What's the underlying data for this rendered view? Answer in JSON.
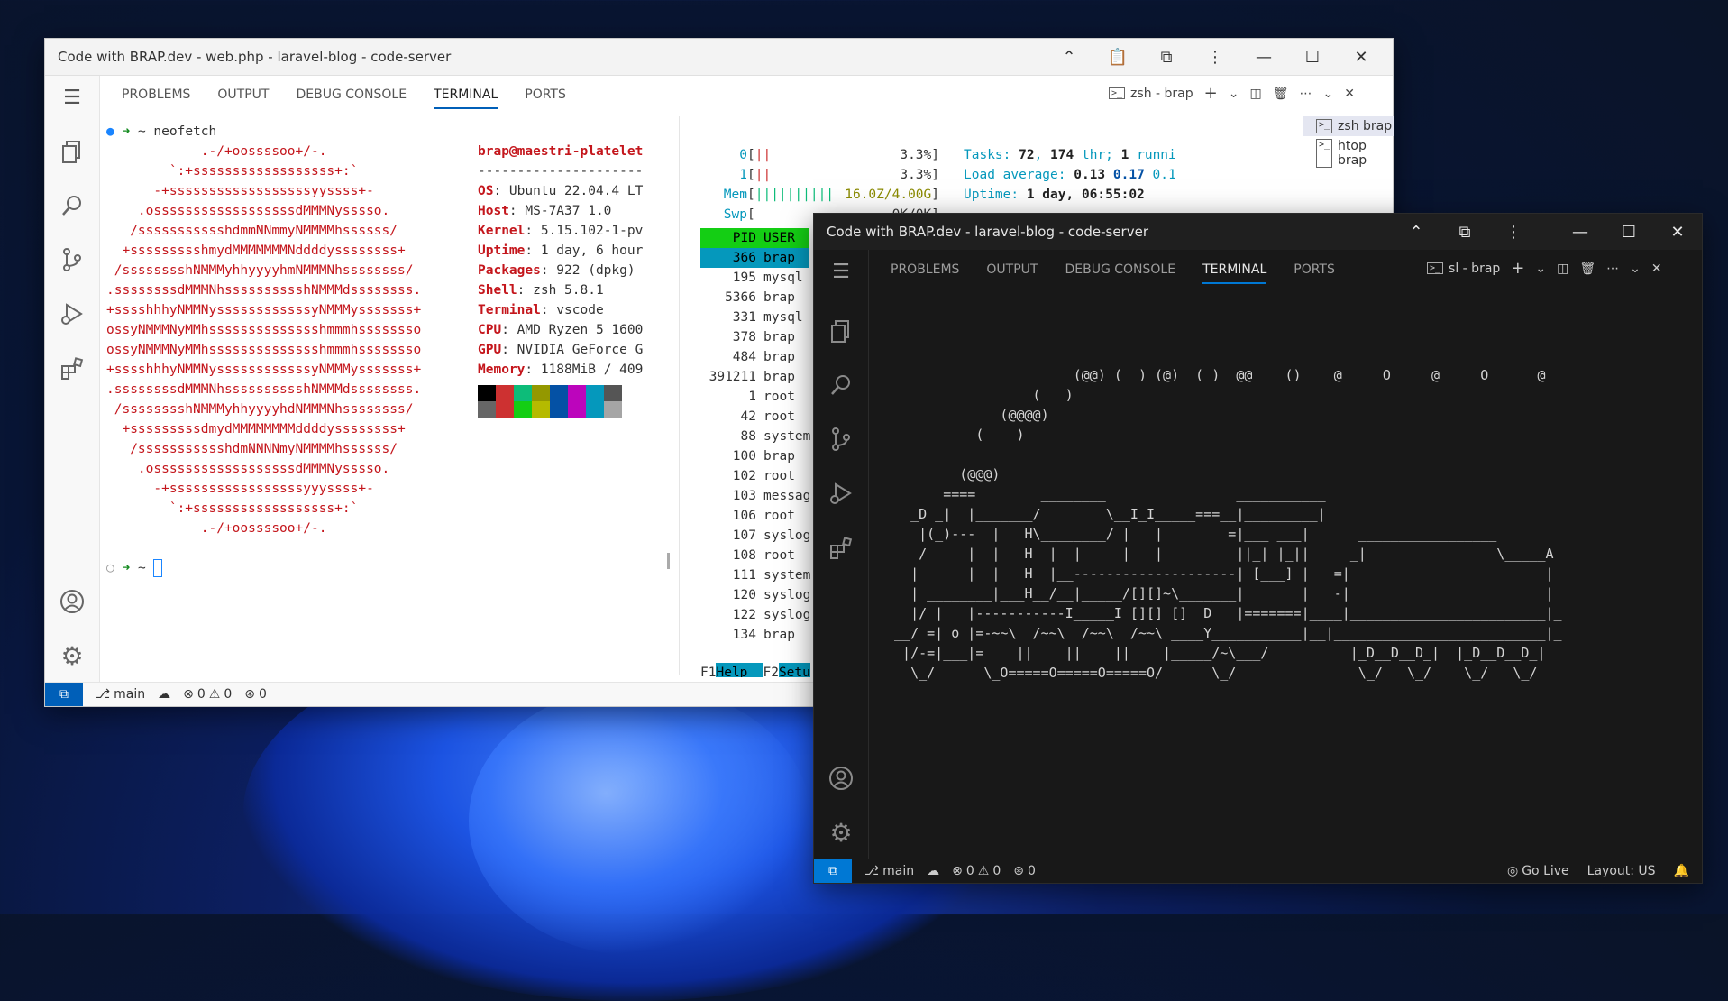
{
  "win1": {
    "title": "Code with BRAP.dev - web.php - laravel-blog - code-server",
    "tabs": [
      "PROBLEMS",
      "OUTPUT",
      "DEBUG CONSOLE",
      "TERMINAL",
      "PORTS"
    ],
    "terminal_selector": "zsh - brap",
    "terminal_list": [
      "zsh brap",
      "htop brap"
    ],
    "prompt1": "~ neofetch",
    "prompt2": "~",
    "logo": [
      "            .-/+oossssoo+/-.",
      "        `:+ssssssssssssssssss+:`",
      "      -+ssssssssssssssssssyyssss+-",
      "    .ossssssssssssssssssdMMMNysssso.",
      "   /ssssssssssshdmmNNmmyNMMMMhssssss/",
      "  +ssssssssshmydMMMMMMMNddddyssssssss+",
      " /sssssssshNMMMyhhyyyyhmNMMMNhssssssss/",
      ".ssssssssdMMMNhsssssssssshNMMMdssssssss.",
      "+sssshhhyNMMNyssssssssssssyNMMMysssssss+",
      "ossyNMMMNyMMhsssssssssssssshmmmhssssssso",
      "ossyNMMMNyMMhsssssssssssssshmmmhssssssso",
      "+sssshhhyNMMNyssssssssssssyNMMMysssssss+",
      ".ssssssssdMMMNhsssssssssshNMMMdssssssss.",
      " /sssssssshNMMMyhhyyyyhdNMMMNhssssssss/",
      "  +sssssssssdmydMMMMMMMMddddyssssssss+",
      "   /ssssssssssshdmNNNNmyNMMMMhssssss/",
      "    .ossssssssssssssssssdMMMNysssso.",
      "      -+sssssssssssssssssyyyssss+-",
      "        `:+ssssssssssssssssss+:`",
      "            .-/+oossssoo+/-."
    ],
    "userhost": "brap@maestri-platelet",
    "separator": "---------------------",
    "info": [
      {
        "k": "OS",
        "v": ": Ubuntu 22.04.4 LT"
      },
      {
        "k": "Host",
        "v": ": MS-7A37 1.0"
      },
      {
        "k": "Kernel",
        "v": ": 5.15.102-1-pv"
      },
      {
        "k": "Uptime",
        "v": ": 1 day, 6 hour"
      },
      {
        "k": "Packages",
        "v": ": 922 (dpkg)"
      },
      {
        "k": "Shell",
        "v": ": zsh 5.8.1"
      },
      {
        "k": "Terminal",
        "v": ": vscode"
      },
      {
        "k": "CPU",
        "v": ": AMD Ryzen 5 1600"
      },
      {
        "k": "GPU",
        "v": ": NVIDIA GeForce G"
      },
      {
        "k": "Memory",
        "v": ": 1188MiB / 409"
      }
    ],
    "palette_top": [
      "#000000",
      "#cd3131",
      "#0dbc79",
      "#949800",
      "#0451a5",
      "#bc05bc",
      "#0598bc",
      "#555555"
    ],
    "palette_bottom": [
      "#666666",
      "#cd3131",
      "#14ce14",
      "#b5ba00",
      "#0451a5",
      "#bc05bc",
      "#0598bc",
      "#a5a5a5"
    ],
    "htop": {
      "cpu0": {
        "label": "0",
        "bars": "||",
        "pct": "3.3%"
      },
      "cpu1": {
        "label": "1",
        "bars": "||",
        "pct": "3.3%"
      },
      "mem": {
        "label": "Mem",
        "bars": "||||||||||",
        "val": "16.0Z/4.00G"
      },
      "swp": {
        "label": "Swp",
        "val": "0K/0K"
      },
      "tasks": "Tasks: ",
      "tasks_n1": "72",
      "tasks_sep": ", ",
      "tasks_n2": "174",
      "tasks_rest": " thr; ",
      "tasks_n3": "1",
      "tasks_tail": " runni",
      "load": "Load average: ",
      "load1": "0.13",
      "load2": "0.17",
      "load3": "0.1",
      "uptime_label": "Uptime: ",
      "uptime_val": "1 day, 06:55:02",
      "header_pid": "PID",
      "header_user": "USER",
      "rows": [
        {
          "pid": "366",
          "user": "brap"
        },
        {
          "pid": "195",
          "user": "mysql"
        },
        {
          "pid": "5366",
          "user": "brap"
        },
        {
          "pid": "331",
          "user": "mysql"
        },
        {
          "pid": "378",
          "user": "brap"
        },
        {
          "pid": "484",
          "user": "brap"
        },
        {
          "pid": "391211",
          "user": "brap"
        },
        {
          "pid": "1",
          "user": "root"
        },
        {
          "pid": "42",
          "user": "root"
        },
        {
          "pid": "88",
          "user": "system"
        },
        {
          "pid": "100",
          "user": "brap"
        },
        {
          "pid": "102",
          "user": "root"
        },
        {
          "pid": "103",
          "user": "messag"
        },
        {
          "pid": "106",
          "user": "root"
        },
        {
          "pid": "107",
          "user": "syslog"
        },
        {
          "pid": "108",
          "user": "root"
        },
        {
          "pid": "111",
          "user": "system"
        },
        {
          "pid": "120",
          "user": "syslog"
        },
        {
          "pid": "122",
          "user": "syslog"
        },
        {
          "pid": "134",
          "user": "brap"
        }
      ],
      "f1": "F1",
      "f1_label": "Help",
      "f2": "F2",
      "f2_label": "Setu"
    },
    "status": {
      "branch": "main",
      "errors": "0",
      "warnings": "0",
      "ports": "0"
    }
  },
  "win2": {
    "title": "Code with BRAP.dev - laravel-blog - code-server",
    "tabs": [
      "PROBLEMS",
      "OUTPUT",
      "DEBUG CONSOLE",
      "TERMINAL",
      "PORTS"
    ],
    "terminal_selector": "sl - brap",
    "train": [
      "                       (@@) (  ) (@)  ( )  @@    ()    @     O     @     O      @",
      "                  (   )",
      "              (@@@@)",
      "           (    )",
      "",
      "         (@@@)",
      "       ====        ________                ___________",
      "   _D _|  |_______/        \\__I_I_____===__|_________|",
      "    |(_)---  |   H\\________/ |   |        =|___ ___|      _________________",
      "    /     |  |   H  |  |     |   |         ||_| |_||     _|                \\_____A",
      "   |      |  |   H  |__--------------------| [___] |   =|                        |",
      "   | ________|___H__/__|_____/[][]~\\_______|       |   -|                        |",
      "   |/ |   |-----------I_____I [][] []  D   |=======|____|________________________|_",
      " __/ =| o |=-~~\\  /~~\\  /~~\\  /~~\\ ____Y___________|__|__________________________|_",
      "  |/-=|___|=    ||    ||    ||    |_____/~\\___/          |_D__D__D_|  |_D__D__D_|",
      "   \\_/      \\_O=====O=====O=====O/      \\_/               \\_/   \\_/    \\_/   \\_/"
    ],
    "status": {
      "branch": "main",
      "errors": "0",
      "warnings": "0",
      "ports": "0",
      "golive": "Go Live",
      "layout": "Layout: US"
    }
  }
}
